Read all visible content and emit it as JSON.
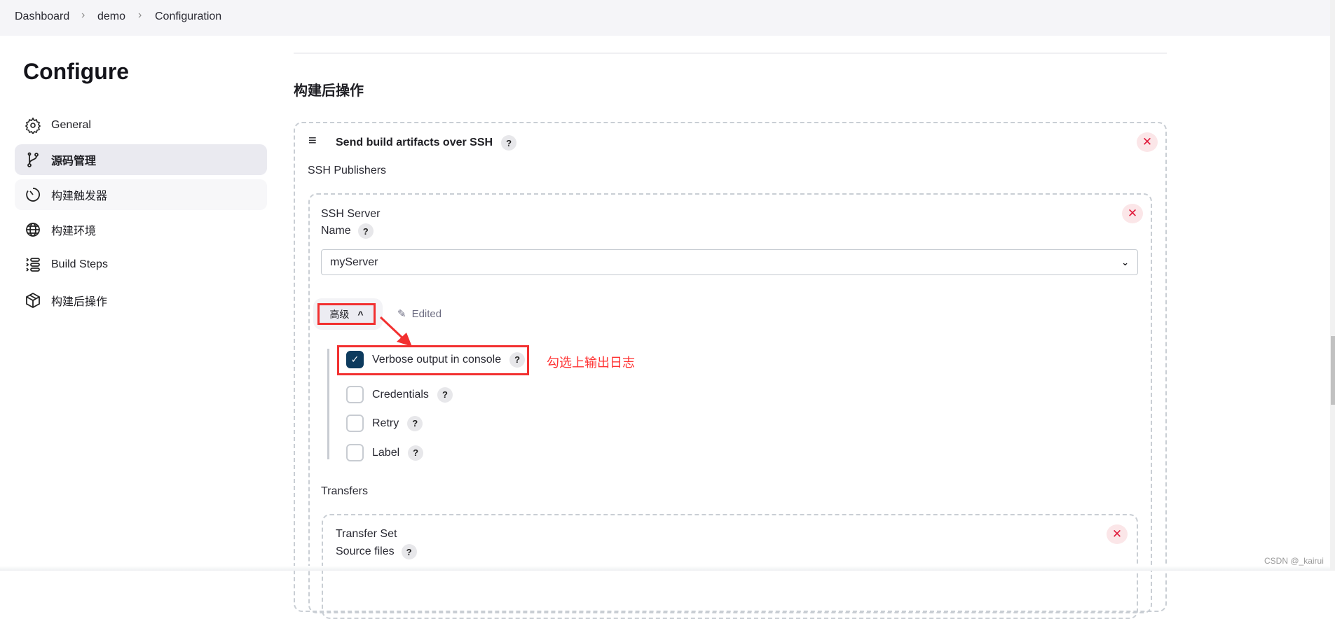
{
  "breadcrumb": [
    "Dashboard",
    "demo",
    "Configuration"
  ],
  "sidebar": {
    "title": "Configure",
    "items": [
      {
        "label": "General",
        "icon": "gear-icon"
      },
      {
        "label": "源码管理",
        "icon": "branch-icon",
        "active": true
      },
      {
        "label": "构建触发器",
        "icon": "timer-icon"
      },
      {
        "label": "构建环境",
        "icon": "globe-icon"
      },
      {
        "label": "Build Steps",
        "icon": "list-icon"
      },
      {
        "label": "构建后操作",
        "icon": "package-icon"
      }
    ]
  },
  "main": {
    "section_title": "构建后操作",
    "publisher": {
      "title": "Send build artifacts over SSH",
      "help": "?",
      "ssh_publishers_label": "SSH Publishers",
      "server": {
        "section_label": "SSH Server",
        "name_label": "Name",
        "name_value": "myServer",
        "advanced_button": "高级",
        "edited_label": "Edited",
        "options": [
          {
            "label": "Verbose output in console",
            "checked": true
          },
          {
            "label": "Credentials",
            "checked": false
          },
          {
            "label": "Retry",
            "checked": false
          },
          {
            "label": "Label",
            "checked": false
          }
        ],
        "transfers_label": "Transfers",
        "transfer_set": {
          "title": "Transfer Set",
          "source_files_label": "Source files"
        }
      }
    }
  },
  "annotation": {
    "text": "勾选上输出日志",
    "color": "#ff3333"
  },
  "watermark": "CSDN @_kairui",
  "colors": {
    "checkbox_checked": "#0d3b5e",
    "close_button": "#e0193a"
  }
}
